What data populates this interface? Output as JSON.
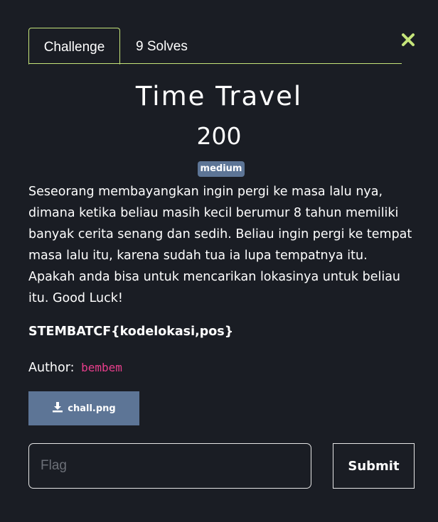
{
  "tabs": {
    "challenge_label": "Challenge",
    "solves_label": "9 Solves"
  },
  "challenge": {
    "name": "Time Travel",
    "points": "200",
    "difficulty": "medium",
    "description": "Seseorang membayangkan ingin pergi ke masa lalu nya, dimana ketika beliau masih kecil berumur 8 tahun memiliki banyak cerita senang dan sedih. Beliau ingin pergi ke tempat masa lalu itu, karena sudah tua ia lupa tempatnya itu. Apakah anda bisa untuk mencarikan lokasinya untuk beliau itu. Good Luck!",
    "flag_format": "STEMBATCF{kodelokasi,pos}",
    "author_label": "Author:",
    "author_name": "bembem",
    "file_name": "chall.png"
  },
  "submission": {
    "flag_placeholder": "Flag",
    "flag_value": "",
    "submit_label": "Submit"
  },
  "icons": {
    "close": "close-icon",
    "download": "download-icon"
  },
  "colors": {
    "background": "#1a1d24",
    "accent": "#c5e47a",
    "badge": "#5d7596",
    "author": "#e83e8c"
  }
}
